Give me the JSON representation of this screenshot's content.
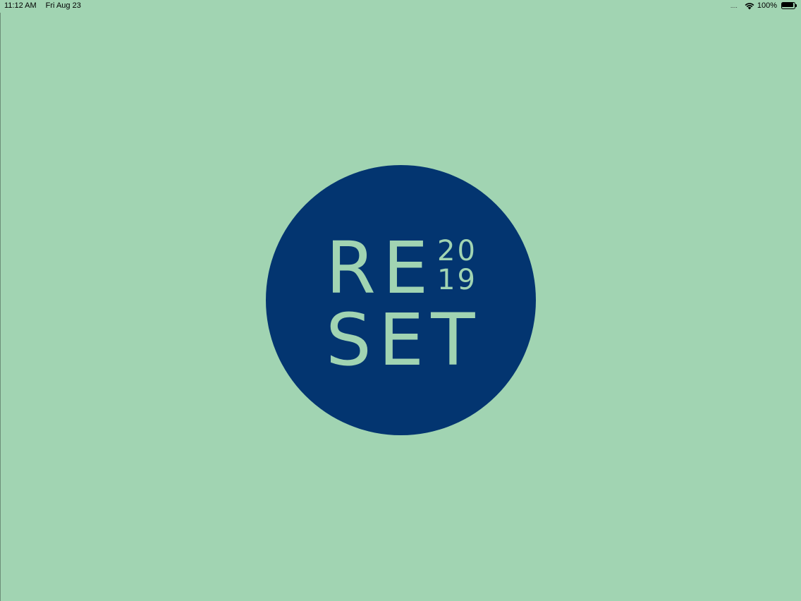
{
  "status_bar": {
    "time": "11:12 AM",
    "date": "Fri Aug 23",
    "signal": "....",
    "battery_percent": "100%",
    "icons": [
      "wifi-icon",
      "battery-icon"
    ]
  },
  "splash": {
    "logo": {
      "line1": "RE",
      "year_top": "20",
      "year_bottom": "19",
      "line2": "SET"
    }
  },
  "colors": {
    "background": "#a1d4b2",
    "logo_circle": "#033570",
    "logo_text": "#a1d4b2"
  }
}
